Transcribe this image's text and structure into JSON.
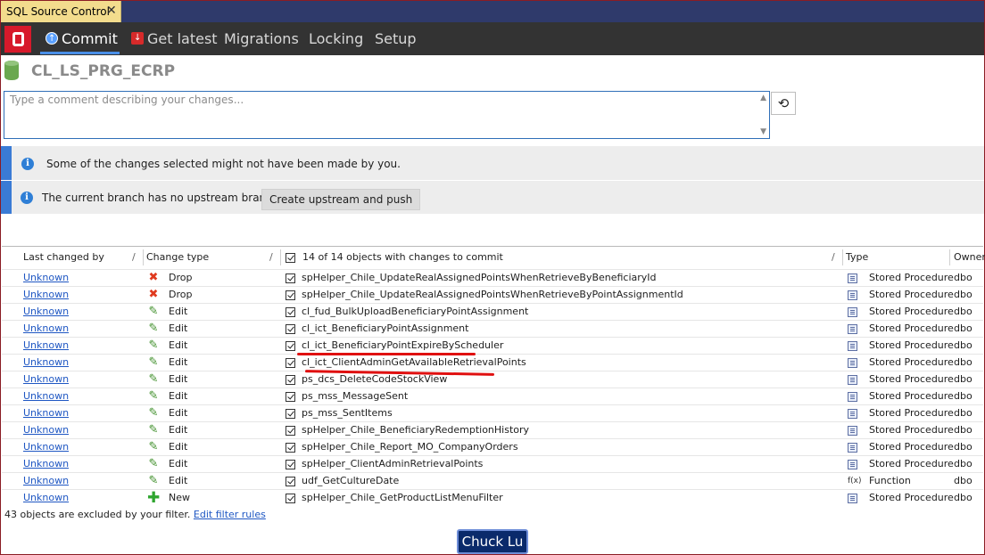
{
  "document_tab": {
    "title": "SQL Source Control",
    "close_glyph": "✕"
  },
  "nav": {
    "tabs": [
      {
        "label": "Commit",
        "active": true
      },
      {
        "label": "Get latest",
        "active": false
      },
      {
        "label": "Migrations",
        "active": false
      },
      {
        "label": "Locking",
        "active": false
      },
      {
        "label": "Setup",
        "active": false
      }
    ]
  },
  "database": {
    "name": "CL_LS_PRG_ECRP"
  },
  "comment": {
    "placeholder": "Type a comment describing your changes..."
  },
  "history_button": {
    "glyph": "⟲"
  },
  "info": {
    "changes_not_yours": "Some of the changes selected might not have been made by you.",
    "no_upstream": "The current branch has no upstream branch.",
    "upstream_button": "Create upstream and push"
  },
  "grid": {
    "headers": {
      "last_changed_by": "Last changed by",
      "change_type": "Change type",
      "objects": "14 of 14 objects with changes to commit",
      "type": "Type",
      "owner": "Owner"
    },
    "rows": [
      {
        "user": "Unknown",
        "change": "Drop",
        "name": "spHelper_Chile_UpdateRealAssignedPointsWhenRetrieveByBeneficiaryId",
        "type": "Stored Procedure",
        "owner": "dbo"
      },
      {
        "user": "Unknown",
        "change": "Drop",
        "name": "spHelper_Chile_UpdateRealAssignedPointsWhenRetrieveByPointAssignmentId",
        "type": "Stored Procedure",
        "owner": "dbo"
      },
      {
        "user": "Unknown",
        "change": "Edit",
        "name": "cl_fud_BulkUploadBeneficiaryPointAssignment",
        "type": "Stored Procedure",
        "owner": "dbo"
      },
      {
        "user": "Unknown",
        "change": "Edit",
        "name": "cl_ict_BeneficiaryPointAssignment",
        "type": "Stored Procedure",
        "owner": "dbo"
      },
      {
        "user": "Unknown",
        "change": "Edit",
        "name": "cl_ict_BeneficiaryPointExpireByScheduler",
        "type": "Stored Procedure",
        "owner": "dbo"
      },
      {
        "user": "Unknown",
        "change": "Edit",
        "name": "cl_ict_ClientAdminGetAvailableRetrievalPoints",
        "type": "Stored Procedure",
        "owner": "dbo"
      },
      {
        "user": "Unknown",
        "change": "Edit",
        "name": "ps_dcs_DeleteCodeStockView",
        "type": "Stored Procedure",
        "owner": "dbo"
      },
      {
        "user": "Unknown",
        "change": "Edit",
        "name": "ps_mss_MessageSent",
        "type": "Stored Procedure",
        "owner": "dbo"
      },
      {
        "user": "Unknown",
        "change": "Edit",
        "name": "ps_mss_SentItems",
        "type": "Stored Procedure",
        "owner": "dbo"
      },
      {
        "user": "Unknown",
        "change": "Edit",
        "name": "spHelper_Chile_BeneficiaryRedemptionHistory",
        "type": "Stored Procedure",
        "owner": "dbo"
      },
      {
        "user": "Unknown",
        "change": "Edit",
        "name": "spHelper_Chile_Report_MO_CompanyOrders",
        "type": "Stored Procedure",
        "owner": "dbo"
      },
      {
        "user": "Unknown",
        "change": "Edit",
        "name": "spHelper_ClientAdminRetrievalPoints",
        "type": "Stored Procedure",
        "owner": "dbo"
      },
      {
        "user": "Unknown",
        "change": "Edit",
        "name": "udf_GetCultureDate",
        "type": "Function",
        "owner": "dbo"
      },
      {
        "user": "Unknown",
        "change": "New",
        "name": "spHelper_Chile_GetProductListMenuFilter",
        "type": "Stored Procedure",
        "owner": "dbo"
      }
    ]
  },
  "filter": {
    "excluded_text": "43 objects are excluded by your filter.",
    "edit_link": "Edit filter rules"
  },
  "commit_button": {
    "label": "Chuck Lu"
  },
  "colors": {
    "accent": "#3a7bd5",
    "toolbar": "#333333",
    "logo": "#d7192b",
    "tab": "#f3dc8d",
    "annotation": "#e01010"
  }
}
